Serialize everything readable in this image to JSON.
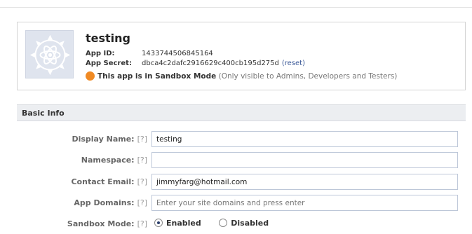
{
  "app": {
    "name": "testing",
    "app_id_label": "App ID:",
    "app_id": "1433744506845164",
    "app_secret_label": "App Secret:",
    "app_secret": "dbca4c2dafc2916629c400cb195d275d",
    "reset_link": "(reset)",
    "sandbox_status": "This app is in Sandbox Mode",
    "sandbox_note": "(Only visible to Admins, Developers and Testers)",
    "icon": "gear-atom-icon",
    "status_color": "#f08a24"
  },
  "section": {
    "title": "Basic Info"
  },
  "form": {
    "hint": "[?]",
    "display_name": {
      "label": "Display Name:",
      "value": "testing"
    },
    "namespace": {
      "label": "Namespace:",
      "value": ""
    },
    "contact_email": {
      "label": "Contact Email:",
      "value": "jimmyfarg@hotmail.com"
    },
    "app_domains": {
      "label": "App Domains:",
      "value": "",
      "placeholder": "Enter your site domains and press enter"
    },
    "sandbox_mode": {
      "label": "Sandbox Mode:",
      "options": [
        "Enabled",
        "Disabled"
      ],
      "selected": "Enabled"
    }
  }
}
